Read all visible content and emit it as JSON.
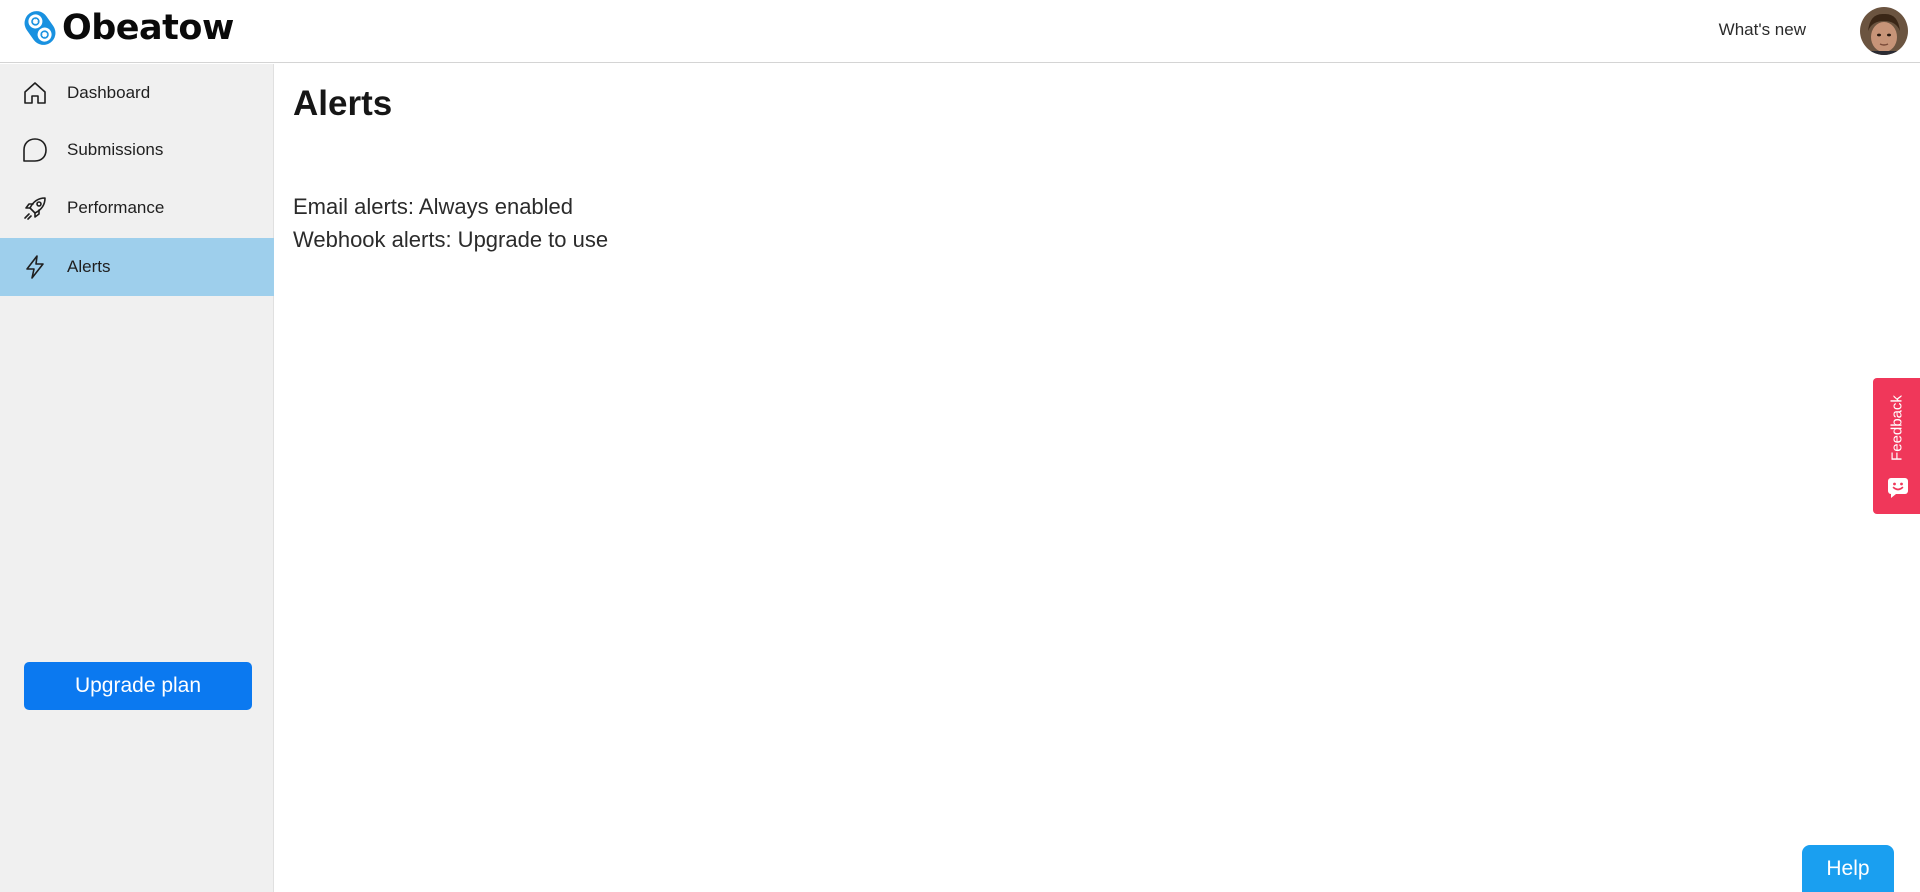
{
  "header": {
    "brand": "Obeatow",
    "whats_new": "What's new",
    "avatar_icon": "user-avatar"
  },
  "sidebar": {
    "items": [
      {
        "label": "Dashboard",
        "icon": "home-icon",
        "active": false
      },
      {
        "label": "Submissions",
        "icon": "chat-bubble-icon",
        "active": false
      },
      {
        "label": "Performance",
        "icon": "rocket-icon",
        "active": false
      },
      {
        "label": "Alerts",
        "icon": "lightning-icon",
        "active": true
      }
    ],
    "upgrade_label": "Upgrade plan"
  },
  "main": {
    "title": "Alerts",
    "lines": [
      "Email alerts: Always enabled",
      "Webhook alerts: Upgrade to use"
    ]
  },
  "feedback": {
    "label": "Feedback",
    "icon": "smiley-icon"
  },
  "help": {
    "label": "Help"
  },
  "colors": {
    "active_nav": "#9ecfec",
    "primary": "#0b79f0",
    "feedback": "#f0375a",
    "help": "#1a9ff0",
    "sidebar_bg": "#f0f0f0"
  }
}
